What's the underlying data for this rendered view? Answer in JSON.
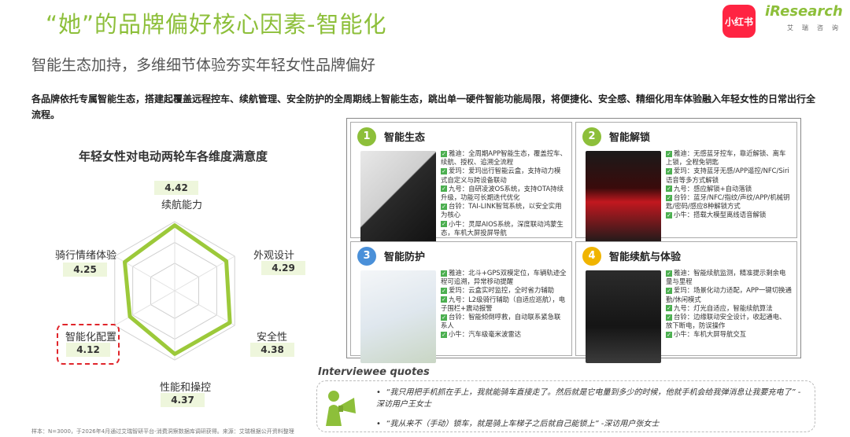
{
  "header": {
    "title": "“她”的品牌偏好核心因素-智能化",
    "subtitle": "智能生态加持，多维细节体验夯实年轻女性品牌偏好",
    "description": "各品牌依托专属智能生态，搭建起覆盖远程控车、续航管理、安全防护的全周期线上智能生态，跳出单一硬件智能功能局限，将便捷化、安全感、精细化用车体验融入年轻女性的日常出行全流程。",
    "logo_xhs": "小红书",
    "logo_ir": "iResearch",
    "logo_ir_cn": "艾瑞咨询"
  },
  "colors": {
    "accent": "#8dbf3a",
    "q1": "#8dbf3a",
    "q2": "#8dbf3a",
    "q3": "#4a90d9",
    "q4": "#f0b400",
    "highlight": "#e0252b"
  },
  "chart_data": {
    "type": "radar",
    "title": "年轻女性对电动两轮车各维度满意度",
    "axes": [
      "续航能力",
      "外观设计",
      "安全性",
      "性能和操控",
      "智能化配置",
      "骑行情绪体验"
    ],
    "values": [
      4.42,
      4.29,
      4.38,
      4.37,
      4.12,
      4.25
    ],
    "labels": [
      "4.42",
      "4.29",
      "4.38",
      "4.37",
      "4.12",
      "4.25"
    ],
    "highlighted": "智能化配置",
    "grid": true
  },
  "quadrants": [
    {
      "num": "1",
      "title": "智能生态",
      "items": [
        "雅迪：全周期APP智能生态，覆盖控车、续航、授权、追溯全流程",
        "爱玛：爱玛出行智能云盒，支持动力模式自定义与跨设备联动",
        "九号：自研凌波OS系统，支持OTA持续升级，功能可长期迭代优化",
        "台铃：TAI-LINK智驾系统，以安全实用为核心",
        "小牛：灵犀AIOS系统，深度联动鸿蒙生态，车机大屏投屏导航"
      ]
    },
    {
      "num": "2",
      "title": "智能解锁",
      "items": [
        "雅迪：无感蓝牙控车，靠近解锁、离车上锁，全程免钥匙",
        "爱玛：支持蓝牙无感/APP遥控/NFC/Siri语音等多方式解锁",
        "九号：感应解锁+自动落锁",
        "台铃：蓝牙/NFC/指纹/声纹/APP/机械钥匙/密码/感应8种解锁方式",
        "小牛：搭载大模型离线语音解锁"
      ]
    },
    {
      "num": "3",
      "title": "智能防护",
      "items": [
        "雅迪：北斗+GPS双模定位，车辆轨迹全程可追溯，异常移动提醒",
        "爱玛：云盒实时监控，全时省力辅助",
        "九号：L2级骑行辅助（自适应巡航），电子围栏+震动报警",
        "台铃：智能倾倒呼救，自动联系紧急联系人",
        "小牛：汽车级毫米波雷达"
      ]
    },
    {
      "num": "4",
      "title": "智能续航与体验",
      "items": [
        "雅迪：智能续航监测，精准提示剩余电量与里程",
        "爱玛：场景化动力适配，APP一键切换通勤/休闲模式",
        "九号：灯光自适应，智能续航算法",
        "台铃：边缘联动安全设计，收起通电、放下断电，防误操作",
        "小牛：车机大屏导航交互"
      ]
    }
  ],
  "quotes": {
    "title": "Interviewee quotes",
    "items": [
      "“我只用把手机抓在手上，我就能骑车直接走了。然后就是它电量到多少的时候，他就手机会给我弹消息让我要充电了” -深访用户王女士",
      "“我从来不（手动）锁车，就是骑上车梯子之后就自己能锁上” -深访用户张女士"
    ]
  },
  "footnote": "样本：N=3000，于2026年4月通过艾瑞智研平台-消费洞察数据库调研获得。来源：艾瑞根据公开资料整理"
}
